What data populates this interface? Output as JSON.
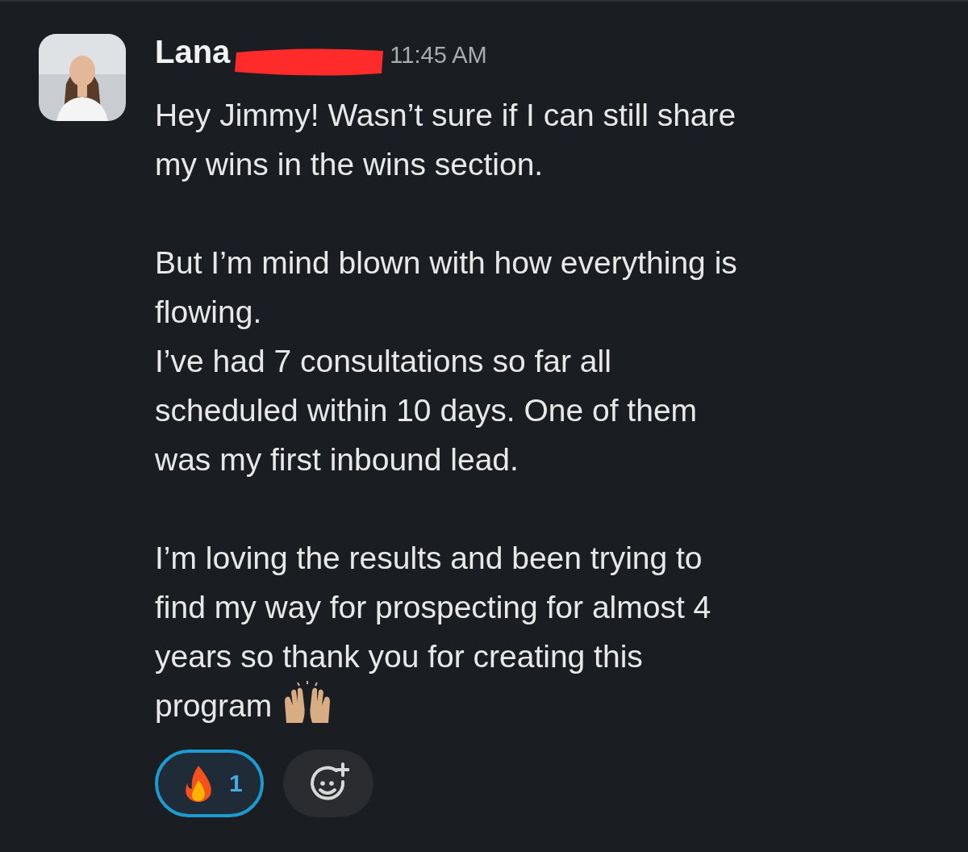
{
  "message": {
    "author": "Lana",
    "time": "11:45 AM",
    "paragraphs": [
      "Hey Jimmy! Wasn’t sure if I can still share\nmy wins in the wins section.",
      "But I’m mind blown with how everything is\nflowing.\nI’ve had 7 consultations so far all\nscheduled within 10 days. One of them\nwas my first inbound lead.",
      "I’m loving the results and been trying to\nfind my way for prospecting for almost 4\nyears so thank you for creating this\nprogram"
    ],
    "reactions": [
      {
        "count": "1",
        "selected": true
      }
    ]
  }
}
